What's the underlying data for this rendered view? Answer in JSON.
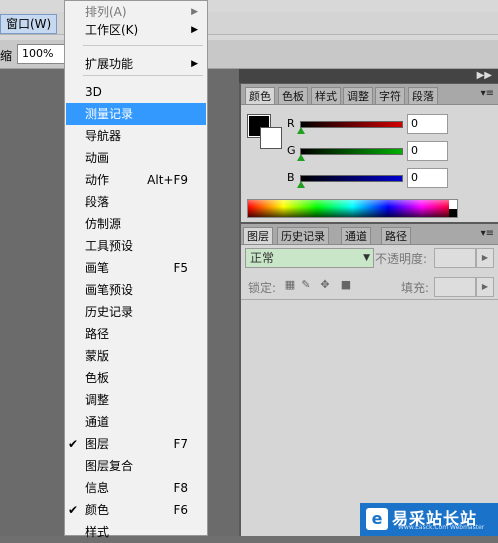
{
  "menubar": {
    "window_menu": "窗口(W)"
  },
  "options_bar": {
    "zoom_label": "缩",
    "zoom_value": "100%"
  },
  "window_menu": {
    "items": [
      {
        "label": "排列(A)",
        "submenu": true,
        "dim": true
      },
      {
        "label": "工作区(K)",
        "submenu": true
      },
      {
        "label": "扩展功能",
        "submenu": true
      },
      {
        "label": "3D"
      },
      {
        "label": "测量记录",
        "highlighted": true
      },
      {
        "label": "导航器"
      },
      {
        "label": "动画"
      },
      {
        "label": "动作",
        "shortcut": "Alt+F9"
      },
      {
        "label": "段落"
      },
      {
        "label": "仿制源"
      },
      {
        "label": "工具预设"
      },
      {
        "label": "画笔",
        "shortcut": "F5"
      },
      {
        "label": "画笔预设"
      },
      {
        "label": "历史记录"
      },
      {
        "label": "路径"
      },
      {
        "label": "蒙版"
      },
      {
        "label": "色板"
      },
      {
        "label": "调整"
      },
      {
        "label": "通道"
      },
      {
        "label": "图层",
        "shortcut": "F7",
        "checked": true
      },
      {
        "label": "图层复合"
      },
      {
        "label": "信息",
        "shortcut": "F8"
      },
      {
        "label": "颜色",
        "shortcut": "F6",
        "checked": true
      },
      {
        "label": "样式"
      }
    ]
  },
  "color_panel": {
    "tabs": [
      "颜色",
      "色板",
      "样式",
      "调整",
      "字符",
      "段落"
    ],
    "active_tab": "颜色",
    "channels": [
      {
        "name": "R",
        "value": "0",
        "color": "#d00000"
      },
      {
        "name": "G",
        "value": "0",
        "color": "#00b000"
      },
      {
        "name": "B",
        "value": "0",
        "color": "#0000d0"
      }
    ],
    "foreground": "#000000",
    "background": "#ffffff"
  },
  "layers_panel": {
    "tabs": [
      "图层",
      "历史记录",
      "通道",
      "路径"
    ],
    "active_tab": "图层",
    "blend_mode": "正常",
    "opacity_label": "不透明度:",
    "lock_label": "锁定:",
    "fill_label": "填充:"
  },
  "watermark": {
    "text": "易采站长站",
    "url": "Www.Easck.Com Webmaster"
  }
}
